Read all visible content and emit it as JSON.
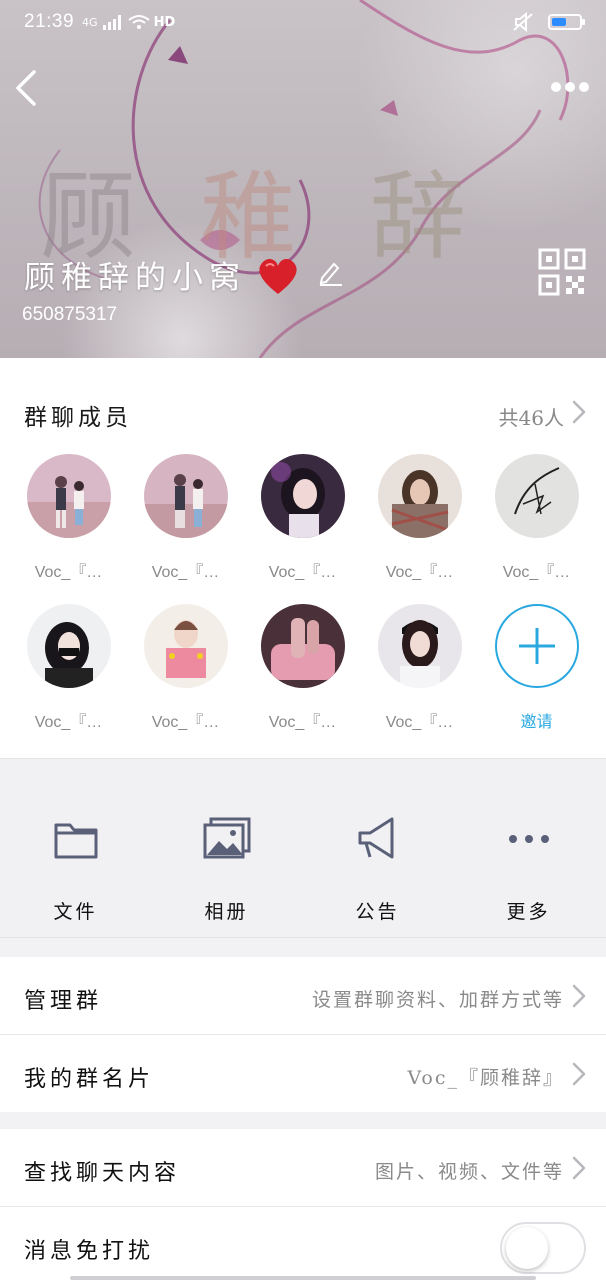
{
  "status_bar": {
    "time": "21:39",
    "network": "4G",
    "hd": "HD"
  },
  "header": {
    "group_name": "顾稚辞的小窝",
    "group_id": "650875317",
    "colors": {
      "overlay_text": "#ffffff"
    }
  },
  "members_section": {
    "title": "群聊成员",
    "count_label": "共46人",
    "members": [
      {
        "name": "Voc_『…",
        "avatar": "couple-photo"
      },
      {
        "name": "Voc_『…",
        "avatar": "couple-photo"
      },
      {
        "name": "Voc_『…",
        "avatar": "girl-portrait"
      },
      {
        "name": "Voc_『…",
        "avatar": "girl-plaid"
      },
      {
        "name": "Voc_『…",
        "avatar": "signature-sketch"
      },
      {
        "name": "Voc_『…",
        "avatar": "girl-mask"
      },
      {
        "name": "Voc_『…",
        "avatar": "girl-cartoon"
      },
      {
        "name": "Voc_『…",
        "avatar": "hands-pink"
      },
      {
        "name": "Voc_『…",
        "avatar": "girl-cap"
      }
    ],
    "invite_label": "邀请",
    "accent_color": "#29a8e0"
  },
  "shortcuts": [
    {
      "label": "文件",
      "icon": "folder-icon"
    },
    {
      "label": "相册",
      "icon": "album-icon"
    },
    {
      "label": "公告",
      "icon": "megaphone-icon"
    },
    {
      "label": "更多",
      "icon": "more-dots-icon"
    }
  ],
  "settings": {
    "manage_group": {
      "title": "管理群",
      "value": "设置群聊资料、加群方式等"
    },
    "my_card": {
      "title": "我的群名片",
      "value": "Voc_『顾稚辞』"
    },
    "search_history": {
      "title": "查找聊天内容",
      "value": "图片、视频、文件等"
    },
    "do_not_disturb": {
      "title": "消息免打扰",
      "enabled": false
    }
  }
}
